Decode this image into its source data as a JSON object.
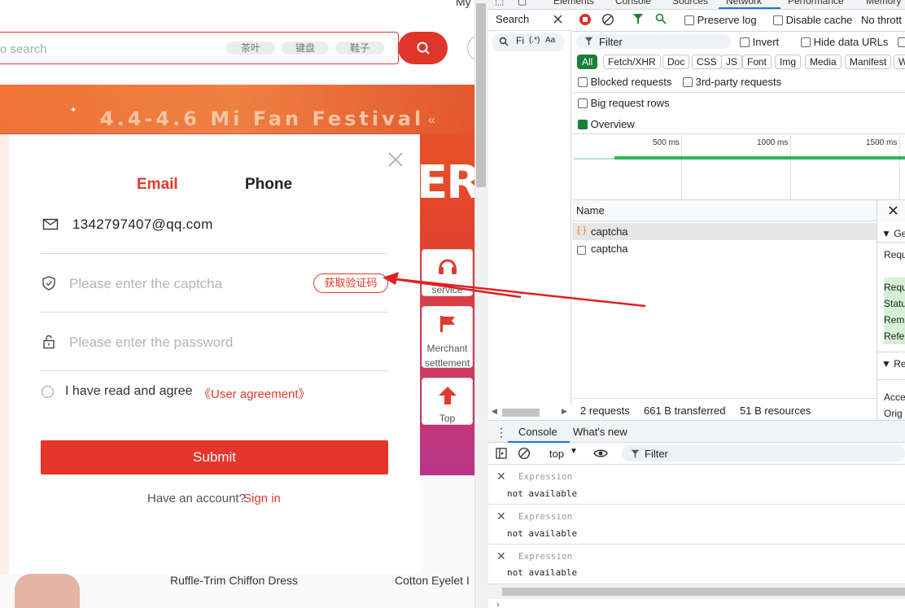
{
  "site": {
    "top_my": "My",
    "search_placeholder": "o search",
    "tags": [
      "茶叶",
      "键盘",
      "鞋子"
    ],
    "banner_title": "4.4-4.6 Mi Fan Festival",
    "banner_big": "ER",
    "side": {
      "service": "service",
      "merchant": "Merchant settlement",
      "top": "Top"
    },
    "products": [
      "Ruffle-Trim Chiffon Dress",
      "Cotton Eyelet I"
    ]
  },
  "modal": {
    "tab_email": "Email",
    "tab_phone": "Phone",
    "email_value": "1342797407@qq.com",
    "captcha_placeholder": "Please enter the captcha",
    "captcha_button": "获取验证码",
    "password_placeholder": "Please enter the password",
    "agree_text": "I have read and agree",
    "agree_link": "《User agreement》",
    "submit": "Submit",
    "have_account": "Have an account?",
    "sign_in": "Sign in"
  },
  "devtools": {
    "top_tabs": [
      "Elements",
      "Console",
      "Sources",
      "Network",
      "Performance",
      "Memory"
    ],
    "search_tab": "Search",
    "search_field": "Fi",
    "search_regex": "(.*)",
    "search_case": "Aa",
    "preserve_log": "Preserve log",
    "disable_cache": "Disable cache",
    "throttle": "No thrott",
    "filter_placeholder": "Filter",
    "invert": "Invert",
    "hide_data_urls": "Hide data URLs",
    "type_filters": [
      "All",
      "Fetch/XHR",
      "Doc",
      "CSS",
      "JS",
      "Font",
      "Img",
      "Media",
      "Manifest",
      "W"
    ],
    "blocked_requests": "Blocked requests",
    "third_party": "3rd-party requests",
    "big_rows": "Big request rows",
    "overview": "Overview",
    "ticks": [
      "500 ms",
      "1000 ms",
      "1500 ms"
    ],
    "name_header": "Name",
    "requests": [
      "captcha",
      "captcha"
    ],
    "detail": {
      "general": "▼ Ger",
      "request": "Requ",
      "req_url": "Requ",
      "status": "Statu",
      "remote": "Rem",
      "referrer": "Refe",
      "response": "▼ Res",
      "accept": "Acce",
      "origin": "Orig"
    },
    "status": {
      "requests": "2 requests",
      "transferred": "661 B transferred",
      "resources": "51 B resources"
    },
    "console_tab": "Console",
    "whats_new": "What's new",
    "context": "top",
    "console_filter": "Filter",
    "expressions": [
      {
        "label": "Expression",
        "value": "not available"
      },
      {
        "label": "Expression",
        "value": "not available"
      },
      {
        "label": "Expression",
        "value": "not available"
      }
    ]
  },
  "colors": {
    "brand_red": "#e23a2e",
    "devtools_green": "#1a7f37",
    "arrow": "#e02020"
  }
}
